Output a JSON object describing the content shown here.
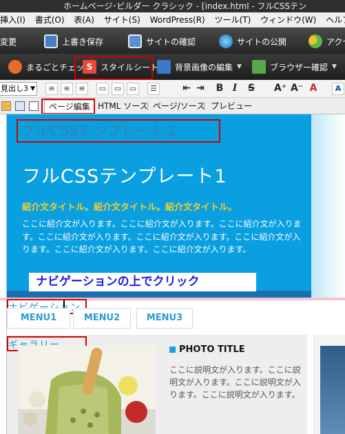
{
  "window": {
    "title": "ホームページ･ビルダー クラシック - [index.html - フルCSSテン"
  },
  "menubar": {
    "items": [
      "挿入(I)",
      "書式(O)",
      "表(A)",
      "サイト(S)",
      "WordPress(R)",
      "ツール(T)",
      "ウィンドウ(W)",
      "ヘルプ(H)"
    ]
  },
  "toolbar1": {
    "change": "変更",
    "overwrite_save": "上書き保存",
    "site_check": "サイトの確認",
    "site_publish": "サイトの公開",
    "access": "アクセ"
  },
  "toolbar2": {
    "whole_check": "まるごとチェック",
    "stylesheet": "スタイルシート",
    "bg_image_edit": "背景画像の編集",
    "browser_check": "ブラウザー確認"
  },
  "toolbar3": {
    "heading_select": "見出し3"
  },
  "tabs": {
    "page_edit": "ページ編集",
    "html_source": "HTML ソース",
    "page_source": "ページ/ソース",
    "preview": "プレビュー"
  },
  "page": {
    "label_template": "フルCSSテンプレート１",
    "hero_title": "フルCSSテンプレート1",
    "intro_title": "紹介文タイトル。紹介文タイトル。紹介文タイトル。",
    "intro_text": "ここに紹介文が入ります。ここに紹介文が入ります。ここに紹介文が入ります。ここに紹介文が入ります。ここに紹介文が入ります。ここに紹介文が入ります。ここに紹介文が入ります。ここに紹介文が入ります。",
    "callout": "ナビゲーションの上でクリック",
    "nav_label": "ナビゲーション",
    "menus": [
      "MENU1",
      "MENU2",
      "MENU3"
    ],
    "gallery_label": "ギャラリー",
    "photo_title": "PHOTO TITLE",
    "photo_desc": "ここに説明文が入ります。ここに説明文が入ります。ここに説明文が入ります。ここに説明文が入ります。"
  },
  "colors": {
    "accent": "#0a9fe0",
    "highlight_box": "#d10000",
    "callout_text": "#1a1ae0",
    "intro_title": "#f3d02a"
  }
}
